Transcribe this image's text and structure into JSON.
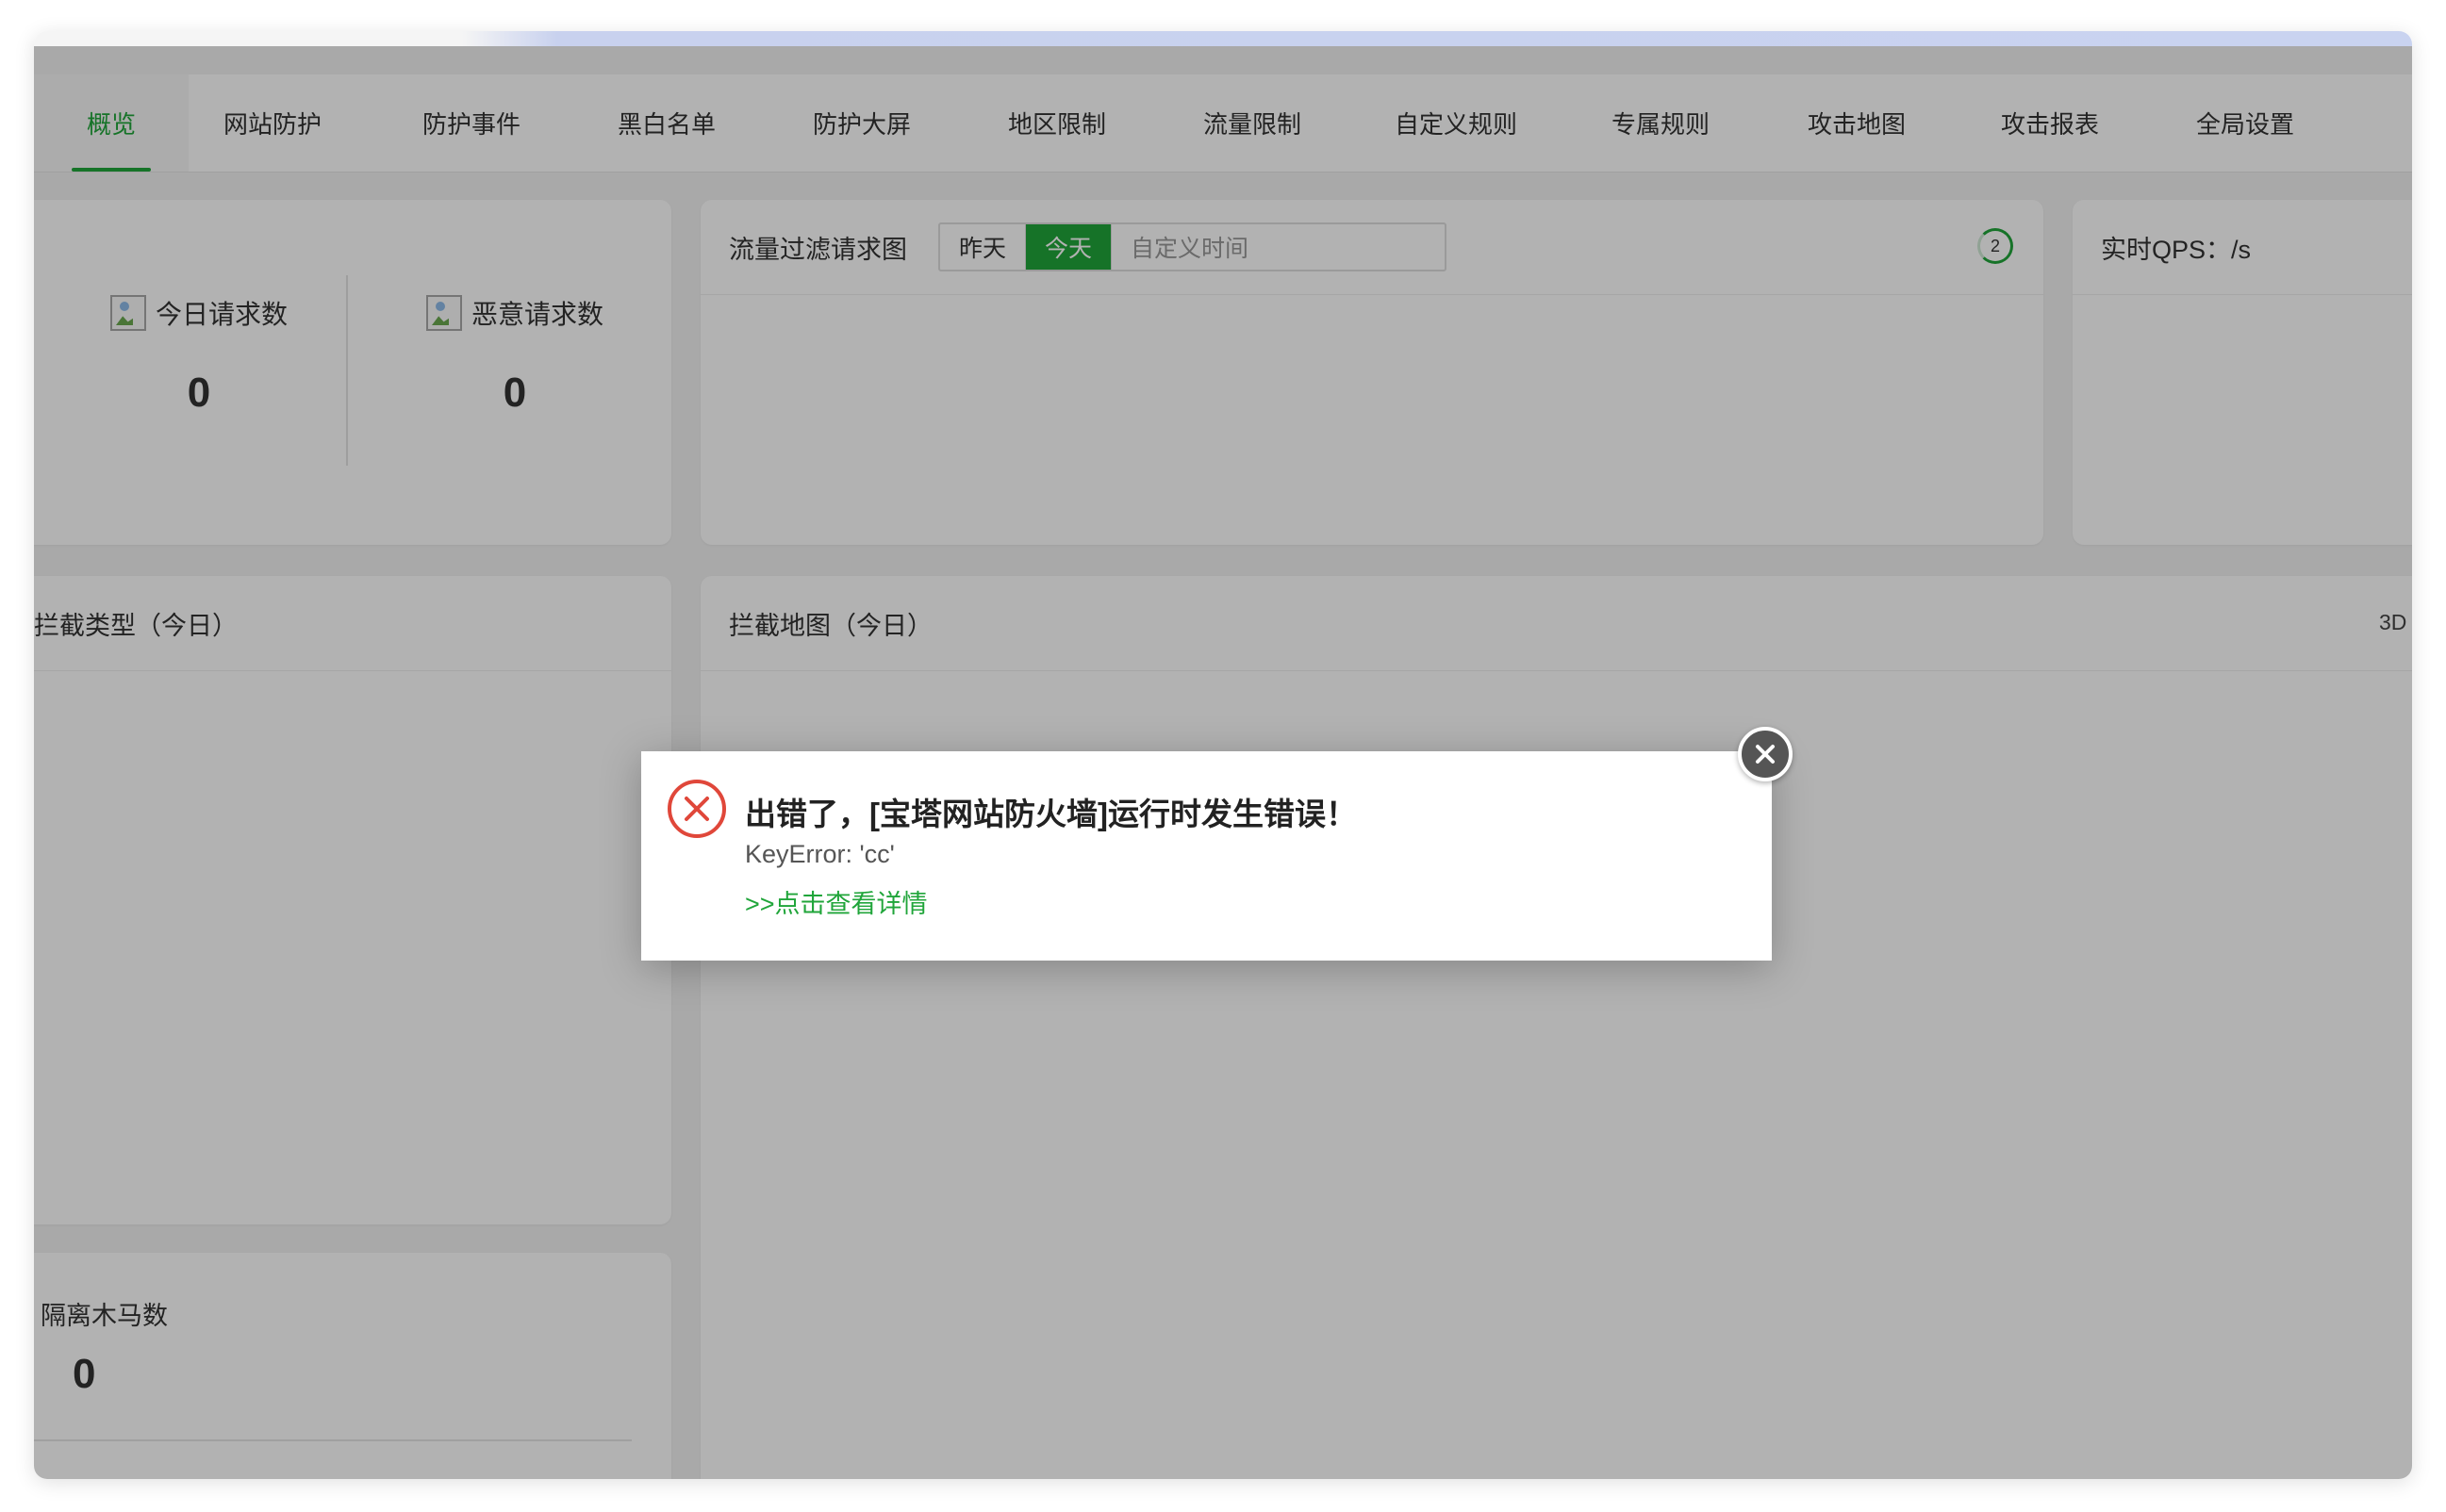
{
  "tabs": [
    {
      "label": "概览",
      "active": true
    },
    {
      "label": "网站防护"
    },
    {
      "label": "防护事件"
    },
    {
      "label": "黑白名单"
    },
    {
      "label": "防护大屏"
    },
    {
      "label": "地区限制"
    },
    {
      "label": "流量限制"
    },
    {
      "label": "自定义规则"
    },
    {
      "label": "专属规则"
    },
    {
      "label": "攻击地图"
    },
    {
      "label": "攻击报表"
    },
    {
      "label": "全局设置"
    }
  ],
  "stats": {
    "today_requests": {
      "label": "今日请求数",
      "value": "0"
    },
    "malicious_requests": {
      "label": "恶意请求数",
      "value": "0"
    }
  },
  "traffic_chart": {
    "title": "流量过滤请求图",
    "buttons": [
      "昨天",
      "今天"
    ],
    "active_button": "今天",
    "custom_time_placeholder": "自定义时间",
    "refresh_count": "2"
  },
  "qps": {
    "title": "实时QPS：/s"
  },
  "intercept_types": {
    "title": "拦截类型（今日）"
  },
  "intercept_map": {
    "title": "拦截地图（今日）",
    "toggle_label": "3D"
  },
  "trojan": {
    "label": "隔离木马数",
    "value": "0"
  },
  "dialog": {
    "title": "出错了，[宝塔网站防火墙]运行时发生错误！",
    "message": "KeyError: 'cc'",
    "link": ">>点击查看详情"
  },
  "colors": {
    "accent": "#20a53a",
    "error": "#e0473a",
    "overlay": "rgba(0,0,0,0.30)"
  }
}
